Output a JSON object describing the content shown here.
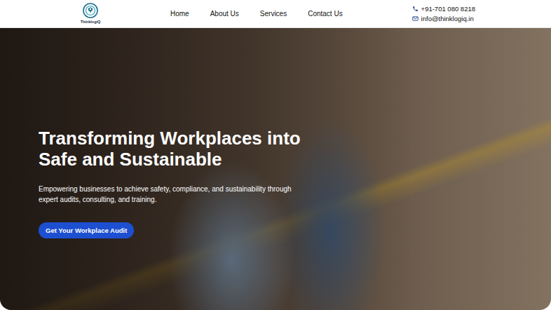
{
  "header": {
    "logo": {
      "text": "ThinklogiQ"
    },
    "nav": [
      {
        "label": "Home"
      },
      {
        "label": "About Us"
      },
      {
        "label": "Services"
      },
      {
        "label": "Contact Us"
      }
    ],
    "contact": {
      "phone": "+91-701 080 8218",
      "email": "info@thinklogiq.in"
    }
  },
  "hero": {
    "title_lines": [
      "Transforming Workplaces into",
      "Safe and Sustainable"
    ],
    "subtitle_lines": [
      "Empowering businesses to achieve safety, compliance, and sustainability through",
      "expert audits, consulting, and training."
    ],
    "button": "Get Your Workplace Audit"
  }
}
